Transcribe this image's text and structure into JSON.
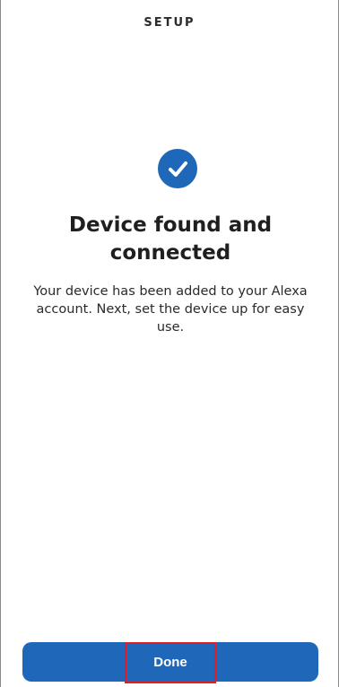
{
  "header": {
    "title": "SETUP"
  },
  "status": {
    "icon": "check-circle-icon",
    "title": "Device found and connected",
    "message": "Your device has been added to your Alexa account. Next, set the device up for easy use."
  },
  "actions": {
    "done_label": "Done"
  },
  "colors": {
    "accent": "#1f68b9",
    "highlight_outline": "#e31b23"
  }
}
